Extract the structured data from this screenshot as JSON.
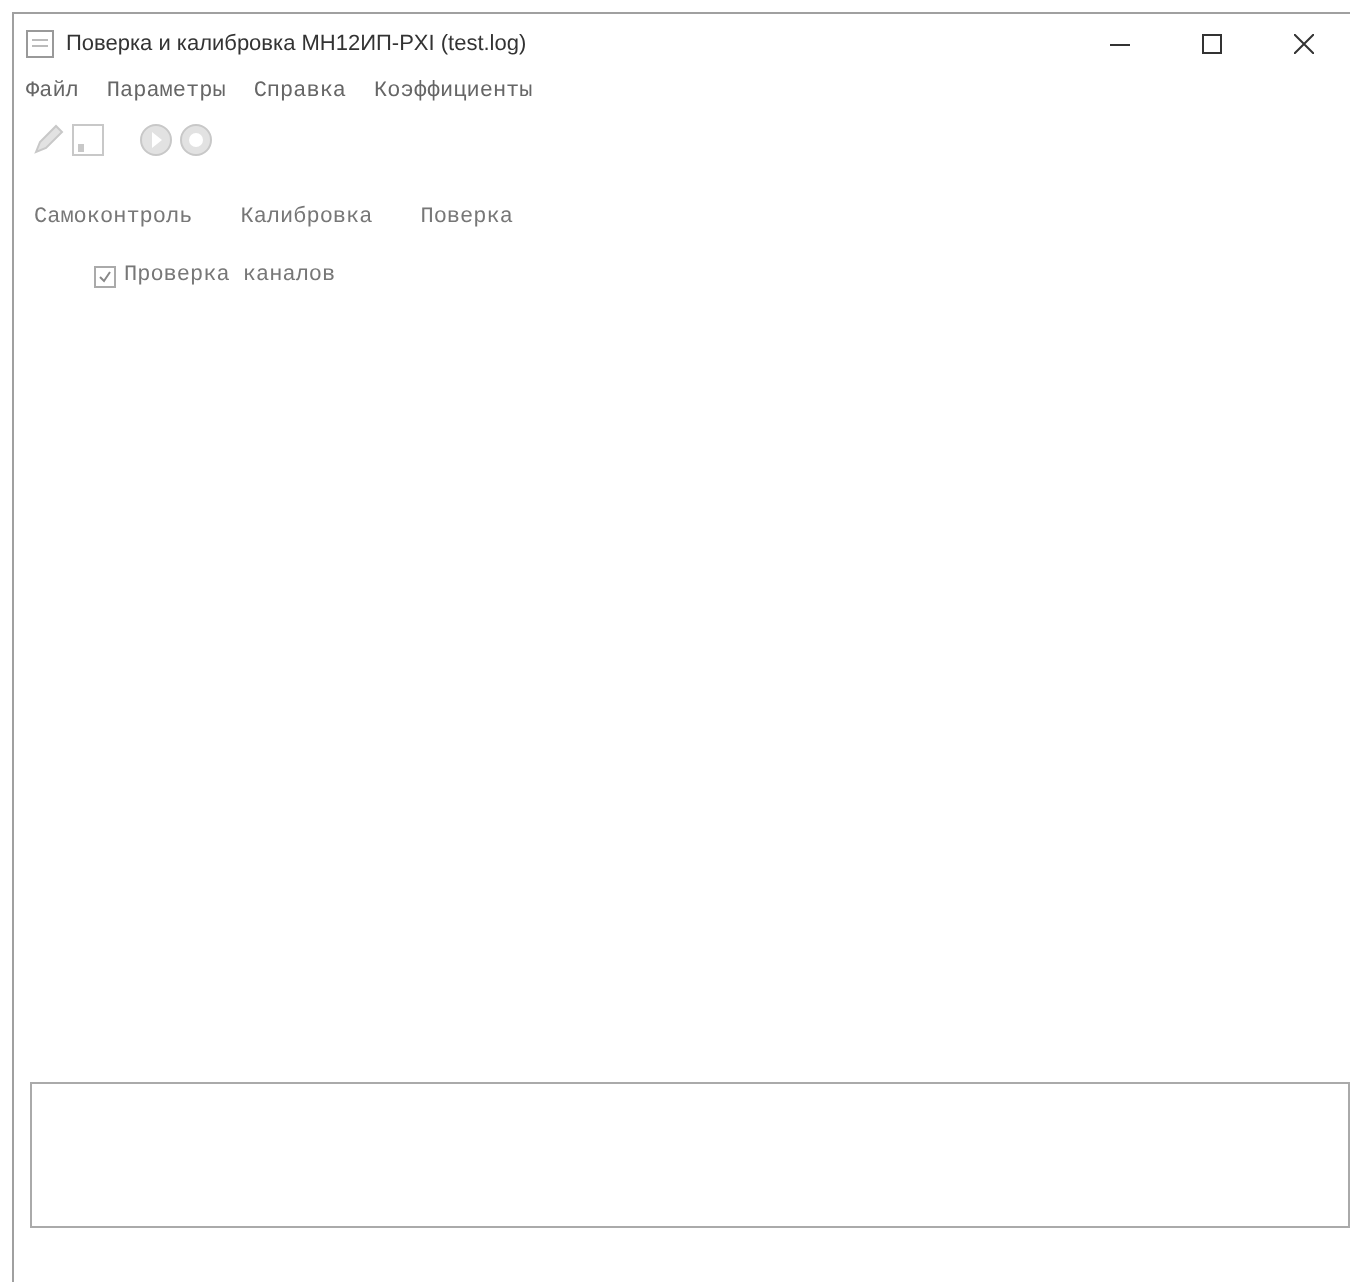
{
  "window": {
    "title": "Поверка и калибровка МН12ИП-PXI (test.log)"
  },
  "menu": [
    "Файл",
    "Параметры",
    "Справка",
    "Коэффициенты"
  ],
  "toolbar": [
    {
      "kind": "pencil",
      "disabled": true
    },
    {
      "kind": "save",
      "disabled": true
    },
    {
      "kind": "run",
      "disabled": true
    },
    {
      "kind": "stop",
      "disabled": true
    }
  ],
  "tabs": [
    {
      "label": "Самоконтроль"
    },
    {
      "label": "Калибровка"
    },
    {
      "label": "Поверка"
    }
  ],
  "checks": [
    {
      "label": "Проверка каналов",
      "checked": true
    }
  ]
}
